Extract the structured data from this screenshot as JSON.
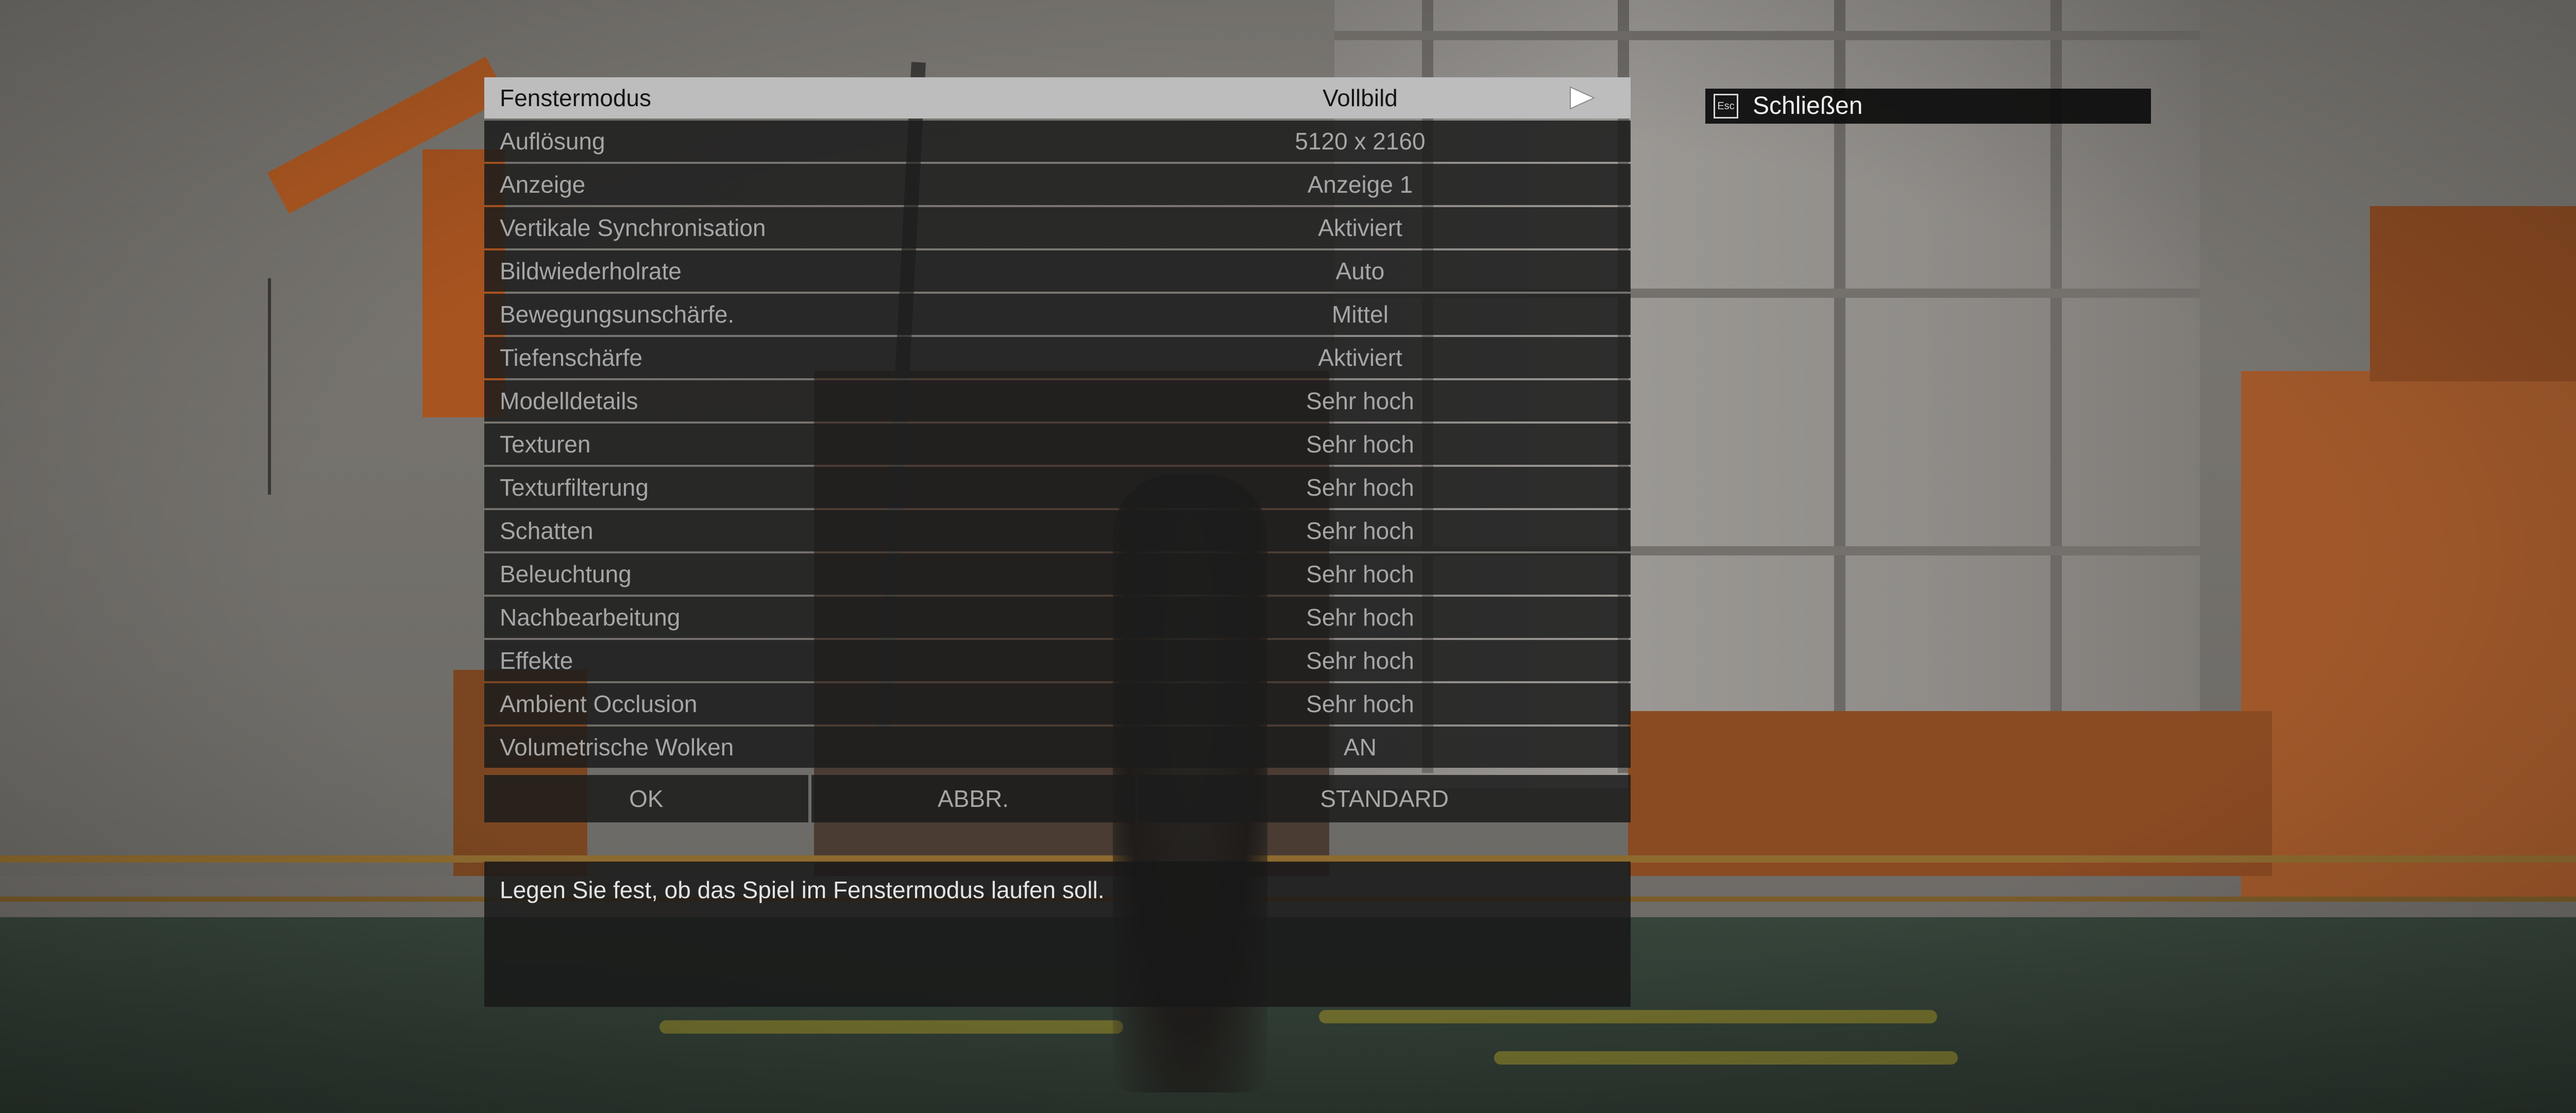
{
  "settings": [
    {
      "label": "Fenstermodus",
      "value": "Vollbild"
    },
    {
      "label": "Auflösung",
      "value": "5120 x 2160"
    },
    {
      "label": "Anzeige",
      "value": "Anzeige 1"
    },
    {
      "label": "Vertikale Synchronisation",
      "value": "Aktiviert"
    },
    {
      "label": "Bildwiederholrate",
      "value": "Auto"
    },
    {
      "label": "Bewegungsunschärfe.",
      "value": "Mittel"
    },
    {
      "label": "Tiefenschärfe",
      "value": "Aktiviert"
    },
    {
      "label": "Modelldetails",
      "value": "Sehr hoch"
    },
    {
      "label": "Texturen",
      "value": "Sehr hoch"
    },
    {
      "label": "Texturfilterung",
      "value": "Sehr hoch"
    },
    {
      "label": "Schatten",
      "value": "Sehr hoch"
    },
    {
      "label": "Beleuchtung",
      "value": "Sehr hoch"
    },
    {
      "label": "Nachbearbeitung",
      "value": "Sehr hoch"
    },
    {
      "label": "Effekte",
      "value": "Sehr hoch"
    },
    {
      "label": "Ambient Occlusion",
      "value": "Sehr hoch"
    },
    {
      "label": "Volumetrische Wolken",
      "value": "AN"
    }
  ],
  "selected_index": 0,
  "buttons": {
    "ok": "OK",
    "cancel": "ABBR.",
    "default": "STANDARD"
  },
  "description": "Legen Sie fest, ob das Spiel im Fenstermodus laufen soll.",
  "close_hint": {
    "key": "Esc",
    "label": "Schließen"
  },
  "colors": {
    "selected_row_bg": "#bdbdbd",
    "row_bg": "#1c1c1c",
    "row_text": "#a6a6a6",
    "selected_text": "#151515"
  }
}
